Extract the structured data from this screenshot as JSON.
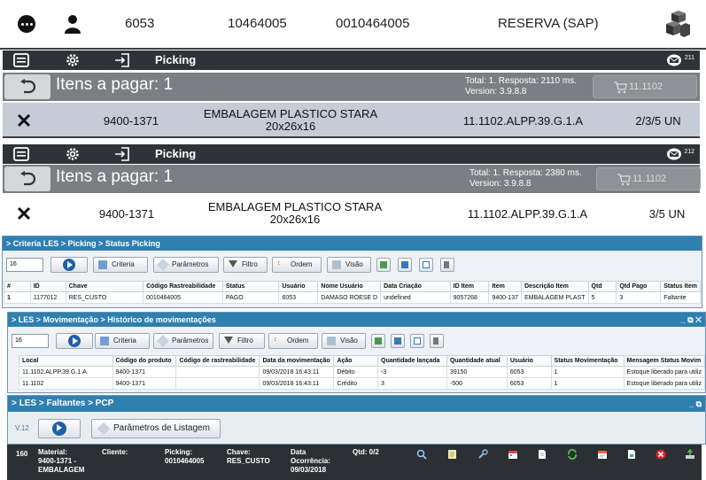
{
  "top_info": {
    "code": "6053",
    "number": "10464005",
    "key": "0010464005",
    "reservation": "RESERVA (SAP)"
  },
  "screen1": {
    "tab_label": "Picking",
    "badge": "211",
    "title": "Itens a pagar: 1",
    "info_line1": "Total: 1. Resposta: 2110 ms.",
    "info_line2": "Version: 3.9.8.8",
    "cart_value": "11.1102",
    "item": {
      "code": "9400-1371",
      "desc_line1": "EMBALAGEM PLASTICO STARA",
      "desc_line2": "20x26x16",
      "location": "11.1102.ALPP.39.G.1.A",
      "qty": "2/3/5 UN"
    }
  },
  "screen2": {
    "tab_label": "Picking",
    "badge": "212",
    "title": "Itens a pagar: 1",
    "info_line1": "Total: 1. Resposta: 2380 ms.",
    "info_line2": "Version: 3.9.8.8",
    "cart_value": "11.1102",
    "item": {
      "code": "9400-1371",
      "desc_line1": "EMBALAGEM PLASTICO STARA",
      "desc_line2": "20x26x16",
      "location": "11.1102.ALPP.39.G.1.A",
      "qty": "3/5 UN"
    }
  },
  "status_picking": {
    "breadcrumb": "> Criteria LES > Picking > Status Picking",
    "page_size": "16",
    "buttons": {
      "criteria": "Criteria",
      "parametros": "Parâmetros",
      "filtro": "Filtro",
      "ordem": "Ordem",
      "visao": "Visão"
    },
    "columns": [
      "#",
      "ID",
      "Chave",
      "Código Rastreabilidade",
      "Status",
      "Usuário",
      "Nome Usuário",
      "Data Criação",
      "ID Item",
      "Item",
      "Descrição Item",
      "Qtd",
      "Qtd Pago",
      "Status Item"
    ],
    "rows": [
      [
        "1",
        "1177012",
        "RES_CUSTO",
        "0010464005",
        "PAGO",
        "6053",
        "DAMASO ROESE D",
        "undefined",
        "9057268",
        "9400-137",
        "EMBALAGEM PLAST",
        "5",
        "3",
        "Faltante"
      ]
    ]
  },
  "historico": {
    "breadcrumb": "> LES > Movimentação > Histórico de movimentações",
    "window_controls": "_ ⧉ ✕",
    "page_size": "16",
    "buttons": {
      "criteria": "Criteria",
      "parametros": "Parâmetros",
      "filtro": "Filtro",
      "ordem": "Ordem",
      "visao": "Visão"
    },
    "columns": [
      "Local",
      "Código do produto",
      "Código de rastreabilidade",
      "Data da movimentação",
      "Ação",
      "Quantidade lançada",
      "Quantidade atual",
      "Usuário",
      "Status Movimentação",
      "Mensagem Status Movim"
    ],
    "rows": [
      [
        "11.1102.ALPP.39.G.1.A",
        "9400-1371",
        "",
        "09/03/2018 16:43:11",
        "Débito",
        "-3",
        "39150",
        "6053",
        "1",
        "Estoque liberado para utiliz"
      ],
      [
        "11.1102",
        "9400-1371",
        "",
        "09/03/2018 16:43:11",
        "Crédito",
        "3",
        "-500",
        "6053",
        "1",
        "Estoque liberado para utiliz"
      ]
    ]
  },
  "faltantes": {
    "breadcrumb": "> LES > Faltantes > PCP",
    "window_controls": "_ ⧉",
    "version": "V.12",
    "list_params_button": "Parâmetros de Listagem",
    "row": {
      "number": "160",
      "material_label": "Material:",
      "material_value1": "9400-1371 -",
      "material_value2": "EMBALAGEM",
      "cliente_label": "Cliente:",
      "picking_label": "Picking:",
      "picking_value": "0010464005",
      "chave_label": "Chave:",
      "chave_value": "RES_CUSTO",
      "data_label1": "Data",
      "data_label2": "Ocorrência:",
      "data_value": "09/03/2018",
      "qtd": "Qtd: 0/2"
    }
  },
  "colors": {
    "dark_bar": "#2f3338",
    "gray_bar": "#7b7e82",
    "selected_row": "#c5ccd6",
    "panel_header": "#2f7fb0"
  }
}
